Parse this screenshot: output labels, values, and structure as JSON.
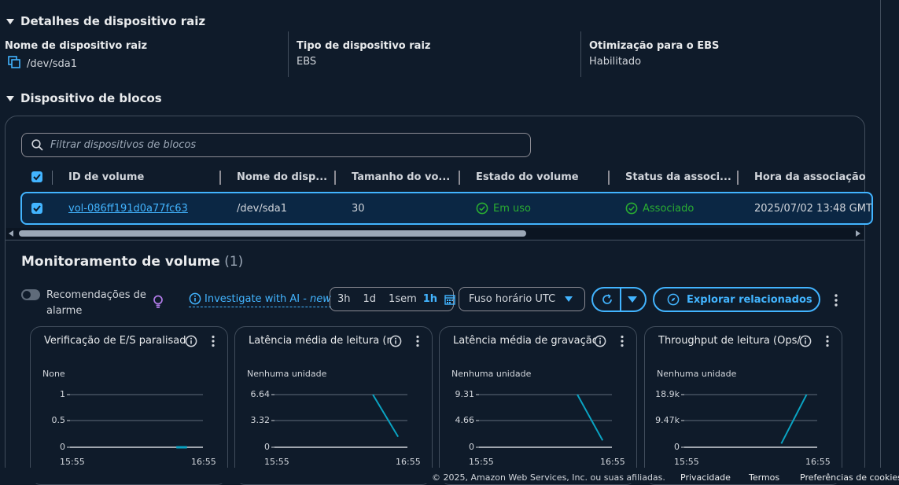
{
  "root_device": {
    "section_title": "Detalhes de dispositivo raiz",
    "fields": [
      {
        "label": "Nome de dispositivo raiz",
        "value": "/dev/sda1"
      },
      {
        "label": "Tipo de dispositivo raiz",
        "value": "EBS"
      },
      {
        "label": "Otimização para o EBS",
        "value": "Habilitado"
      }
    ]
  },
  "block_devices": {
    "section_title": "Dispositivo de blocos",
    "filter_placeholder": "Filtrar dispositivos de blocos",
    "columns": [
      "ID de volume",
      "Nome do disp...",
      "Tamanho do vo...",
      "Estado do volume",
      "Status da associ...",
      "Hora da associação"
    ],
    "row": {
      "volume_id": "vol-086ff191d0a77fc63",
      "device_name": "/dev/sda1",
      "size": "30",
      "state": "Em uso",
      "attach_status": "Associado",
      "attach_time": "2025/07/02 13:48 GMT"
    }
  },
  "monitoring": {
    "title": "Monitoramento de volume",
    "count": "(1)",
    "alarm_toggle_label_1": "Recomendações de",
    "alarm_toggle_label_2": "alarme",
    "investigate_label": "Investigate with AI - ",
    "investigate_new": "new",
    "time_ranges": [
      "3h",
      "1d",
      "1sem",
      "1h"
    ],
    "selected_range": "1h",
    "timezone": "Fuso horário UTC",
    "explore_label": "Explorar relacionados",
    "colors": {
      "accent": "#42b4ff",
      "line": "#0aa3c2",
      "success": "#29ad32",
      "bg": "#0f1b2a"
    }
  },
  "charts": [
    {
      "title": "Verificação de E/S paralisada",
      "unit": "None",
      "yticks": [
        "1",
        "0.5",
        "0"
      ],
      "xticks": [
        "15:55",
        "16:55"
      ]
    },
    {
      "title": "Latência média de leitura (ms/o",
      "unit": "Nenhuma unidade",
      "yticks": [
        "6.64",
        "3.32",
        "0"
      ],
      "xticks": [
        "15:55",
        "16:55"
      ]
    },
    {
      "title": "Latência média de gravação (m",
      "unit": "Nenhuma unidade",
      "yticks": [
        "9.31",
        "4.66",
        "0"
      ],
      "xticks": [
        "15:55",
        "16:55"
      ]
    },
    {
      "title": "Throughput de leitura (Ops/s)",
      "unit": "Nenhuma unidade",
      "yticks": [
        "18.9k",
        "9.47k",
        "0"
      ],
      "xticks": [
        "15:55",
        "16:55"
      ]
    }
  ],
  "footer": {
    "copyright": "© 2025, Amazon Web Services, Inc. ou suas afiliadas.",
    "privacy": "Privacidade",
    "terms": "Termos",
    "cookies": "Preferências de cookies"
  }
}
